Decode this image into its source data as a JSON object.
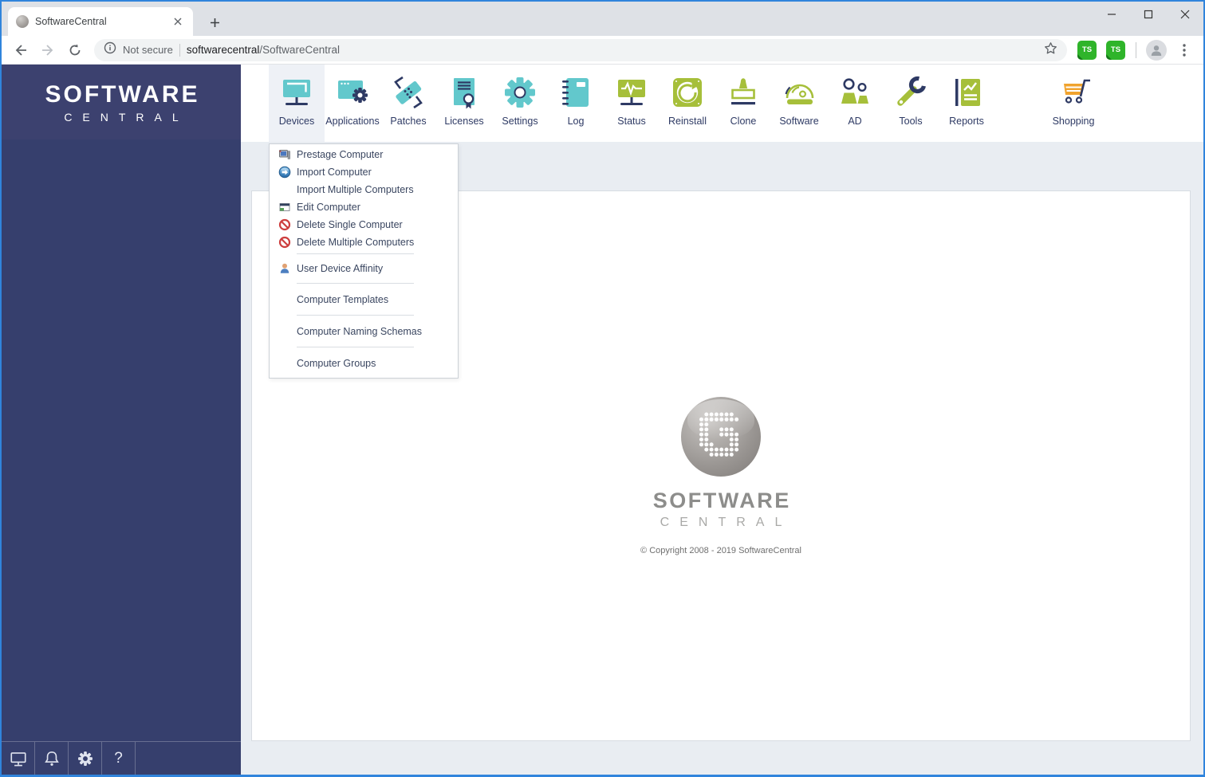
{
  "browser": {
    "tab": {
      "title": "SoftwareCentral"
    },
    "address": {
      "security_label": "Not secure",
      "url_host": "softwarecentral",
      "url_path": "/SoftwareCentral"
    },
    "extensions": [
      {
        "label": "TS"
      },
      {
        "label": "TS"
      }
    ],
    "window_controls": [
      "minimize",
      "maximize",
      "close"
    ]
  },
  "sidebar": {
    "logo_line1": "SOFTWARE",
    "logo_line2": "CENTRAL",
    "footer_icons": [
      "display",
      "notifications",
      "settings",
      "help"
    ],
    "help_glyph": "?"
  },
  "nav": {
    "items": [
      {
        "label": "Devices",
        "icon": "devices-icon",
        "active": true
      },
      {
        "label": "Applications",
        "icon": "applications-icon"
      },
      {
        "label": "Patches",
        "icon": "patches-icon"
      },
      {
        "label": "Licenses",
        "icon": "licenses-icon"
      },
      {
        "label": "Settings",
        "icon": "settings-icon"
      },
      {
        "label": "Log",
        "icon": "log-icon"
      },
      {
        "label": "Status",
        "icon": "status-icon"
      },
      {
        "label": "Reinstall",
        "icon": "reinstall-icon"
      },
      {
        "label": "Clone",
        "icon": "clone-icon"
      },
      {
        "label": "Software",
        "icon": "software-icon"
      },
      {
        "label": "AD",
        "icon": "ad-icon"
      },
      {
        "label": "Tools",
        "icon": "tools-icon"
      },
      {
        "label": "Reports",
        "icon": "reports-icon"
      },
      {
        "label": "Shopping",
        "icon": "shopping-icon"
      }
    ]
  },
  "devices_menu": {
    "items": [
      {
        "label": "Prestage Computer",
        "icon": "computer-icon"
      },
      {
        "label": "Import Computer",
        "icon": "import-icon"
      },
      {
        "label": "Import Multiple Computers",
        "icon": null
      },
      {
        "label": "Edit Computer",
        "icon": "window-icon"
      },
      {
        "label": "Delete Single Computer",
        "icon": "forbidden-icon"
      },
      {
        "label": "Delete Multiple Computers",
        "icon": "forbidden-icon"
      },
      {
        "label": "User Device Affinity",
        "icon": "user-icon"
      },
      {
        "label": "Computer Templates",
        "icon": null
      },
      {
        "label": "Computer Naming Schemas",
        "icon": null
      },
      {
        "label": "Computer Groups",
        "icon": null
      }
    ]
  },
  "content": {
    "logo_line1": "SOFTWARE",
    "logo_line2": "CENTRAL",
    "copyright": "© Copyright 2008 - 2019 SoftwareCentral"
  },
  "colors": {
    "teal": "#62c8cc",
    "navy": "#2e3a64",
    "green": "#a6bf3a",
    "orange": "#f0a32e",
    "sidebar_navy": "#363f6d",
    "danger": "#cd3e3e",
    "window_border": "#3084dc"
  }
}
